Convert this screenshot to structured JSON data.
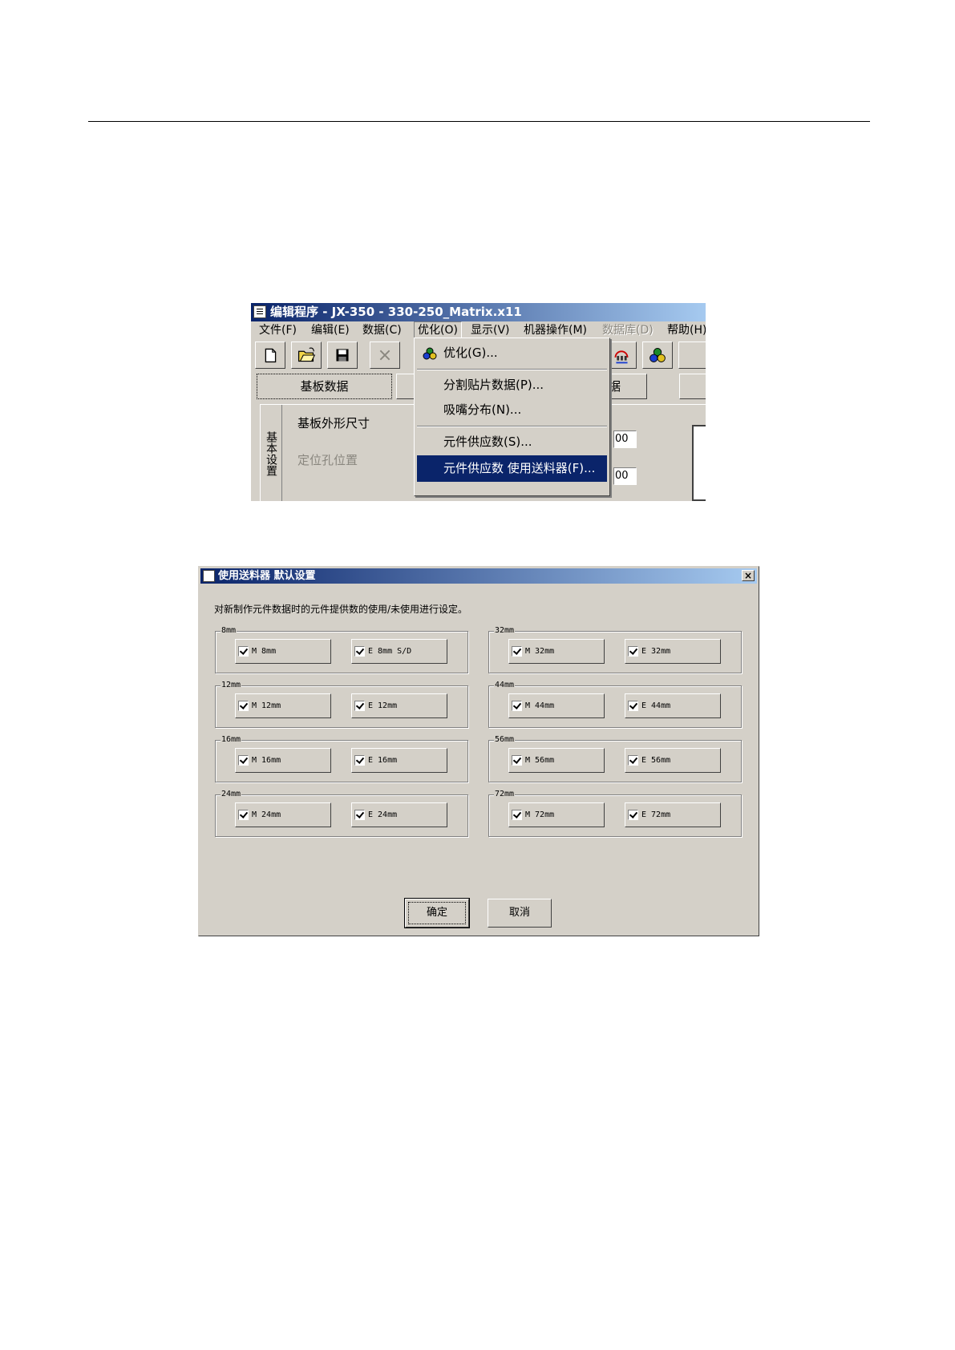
{
  "editor_window": {
    "title": "编辑程序 - JX-350 - 330-250_Matrix.x11",
    "menu": [
      "文件(F)",
      "编辑(E)",
      "数据(C)",
      "优化(O)",
      "显示(V)",
      "机器操作(M)",
      "数据库(D)",
      "帮助(H)"
    ],
    "tabs": [
      "基板数据",
      "数据"
    ],
    "side_tab": "基本设置",
    "field_labels": [
      "基板外形尺寸",
      "定位孔位置"
    ],
    "field_values": [
      "00",
      "00"
    ],
    "optimize_menu": {
      "items": [
        "优化(G)...",
        "分割贴片数据(P)...",
        "吸嘴分布(N)...",
        "元件供应数(S)...",
        "元件供应数 使用送料器(F)..."
      ],
      "highlighted_index": 4
    }
  },
  "feeder_dialog": {
    "title": "使用送料器 默认设置",
    "close_glyph": "×",
    "description": "对新制作元件数据时的元件提供数的使用/未使用进行设定。",
    "groups": [
      {
        "label": "8mm",
        "options": [
          {
            "label": "M 8mm",
            "checked": true
          },
          {
            "label": "E 8mm S/D",
            "checked": true
          }
        ]
      },
      {
        "label": "32mm",
        "options": [
          {
            "label": "M 32mm",
            "checked": true
          },
          {
            "label": "E 32mm",
            "checked": true
          }
        ]
      },
      {
        "label": "12mm",
        "options": [
          {
            "label": "M 12mm",
            "checked": true
          },
          {
            "label": "E 12mm",
            "checked": true
          }
        ]
      },
      {
        "label": "44mm",
        "options": [
          {
            "label": "M 44mm",
            "checked": true
          },
          {
            "label": "E 44mm",
            "checked": true
          }
        ]
      },
      {
        "label": "16mm",
        "options": [
          {
            "label": "M 16mm",
            "checked": true
          },
          {
            "label": "E 16mm",
            "checked": true
          }
        ]
      },
      {
        "label": "56mm",
        "options": [
          {
            "label": "M 56mm",
            "checked": true
          },
          {
            "label": "E 56mm",
            "checked": true
          }
        ]
      },
      {
        "label": "24mm",
        "options": [
          {
            "label": "M 24mm",
            "checked": true
          },
          {
            "label": "E 24mm",
            "checked": true
          }
        ]
      },
      {
        "label": "72mm",
        "options": [
          {
            "label": "M 72mm",
            "checked": true
          },
          {
            "label": "E 72mm",
            "checked": true
          }
        ]
      }
    ],
    "ok_label": "确定",
    "cancel_label": "取消"
  }
}
